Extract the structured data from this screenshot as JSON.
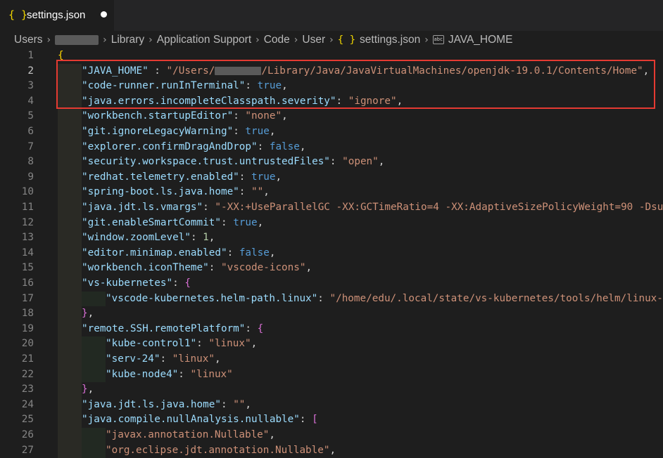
{
  "tab": {
    "icon": "json-braces-icon",
    "label": "settings.json"
  },
  "breadcrumb": {
    "items": [
      "Users",
      "Library",
      "Application Support",
      "Code",
      "User"
    ],
    "file": "settings.json",
    "symbol": "JAVA_HOME",
    "symbol_icon_text": "abc"
  },
  "lines": [
    {
      "n": "1",
      "parts": [
        [
          "br1",
          "{"
        ]
      ]
    },
    {
      "n": "2",
      "parts": [
        [
          "k",
          "\"JAVA_HOME\""
        ],
        [
          "p",
          " : "
        ],
        [
          "s",
          "\"/Users/"
        ],
        [
          "r",
          ""
        ],
        [
          "s",
          "/Library/Java/JavaVirtualMachines/openjdk-19.0.1/Contents/Home\""
        ],
        [
          "p",
          ","
        ]
      ]
    },
    {
      "n": "3",
      "parts": [
        [
          "k",
          "\"code-runner.runInTerminal\""
        ],
        [
          "p",
          ": "
        ],
        [
          "b",
          "true"
        ],
        [
          "p",
          ","
        ]
      ]
    },
    {
      "n": "4",
      "parts": [
        [
          "k",
          "\"java.errors.incompleteClasspath.severity\""
        ],
        [
          "p",
          ": "
        ],
        [
          "s",
          "\"ignore\""
        ],
        [
          "p",
          ","
        ]
      ]
    },
    {
      "n": "5",
      "parts": [
        [
          "k",
          "\"workbench.startupEditor\""
        ],
        [
          "p",
          ": "
        ],
        [
          "s",
          "\"none\""
        ],
        [
          "p",
          ","
        ]
      ]
    },
    {
      "n": "6",
      "parts": [
        [
          "k",
          "\"git.ignoreLegacyWarning\""
        ],
        [
          "p",
          ": "
        ],
        [
          "b",
          "true"
        ],
        [
          "p",
          ","
        ]
      ]
    },
    {
      "n": "7",
      "parts": [
        [
          "k",
          "\"explorer.confirmDragAndDrop\""
        ],
        [
          "p",
          ": "
        ],
        [
          "b",
          "false"
        ],
        [
          "p",
          ","
        ]
      ]
    },
    {
      "n": "8",
      "parts": [
        [
          "k",
          "\"security.workspace.trust.untrustedFiles\""
        ],
        [
          "p",
          ": "
        ],
        [
          "s",
          "\"open\""
        ],
        [
          "p",
          ","
        ]
      ]
    },
    {
      "n": "9",
      "parts": [
        [
          "k",
          "\"redhat.telemetry.enabled\""
        ],
        [
          "p",
          ": "
        ],
        [
          "b",
          "true"
        ],
        [
          "p",
          ","
        ]
      ]
    },
    {
      "n": "10",
      "parts": [
        [
          "k",
          "\"spring-boot.ls.java.home\""
        ],
        [
          "p",
          ": "
        ],
        [
          "s",
          "\"\""
        ],
        [
          "p",
          ","
        ]
      ]
    },
    {
      "n": "11",
      "parts": [
        [
          "k",
          "\"java.jdt.ls.vmargs\""
        ],
        [
          "p",
          ": "
        ],
        [
          "s",
          "\"-XX:+UseParallelGC -XX:GCTimeRatio=4 -XX:AdaptiveSizePolicyWeight=90 -Dsu"
        ]
      ]
    },
    {
      "n": "12",
      "parts": [
        [
          "k",
          "\"git.enableSmartCommit\""
        ],
        [
          "p",
          ": "
        ],
        [
          "b",
          "true"
        ],
        [
          "p",
          ","
        ]
      ]
    },
    {
      "n": "13",
      "parts": [
        [
          "k",
          "\"window.zoomLevel\""
        ],
        [
          "p",
          ": "
        ],
        [
          "n",
          "1"
        ],
        [
          "p",
          ","
        ]
      ]
    },
    {
      "n": "14",
      "parts": [
        [
          "k",
          "\"editor.minimap.enabled\""
        ],
        [
          "p",
          ": "
        ],
        [
          "b",
          "false"
        ],
        [
          "p",
          ","
        ]
      ]
    },
    {
      "n": "15",
      "parts": [
        [
          "k",
          "\"workbench.iconTheme\""
        ],
        [
          "p",
          ": "
        ],
        [
          "s",
          "\"vscode-icons\""
        ],
        [
          "p",
          ","
        ]
      ]
    },
    {
      "n": "16",
      "parts": [
        [
          "k",
          "\"vs-kubernetes\""
        ],
        [
          "p",
          ": "
        ],
        [
          "br2",
          "{"
        ]
      ]
    },
    {
      "n": "17",
      "parts": [
        [
          "k",
          "\"vscode-kubernetes.helm-path.linux\""
        ],
        [
          "p",
          ": "
        ],
        [
          "s",
          "\"/home/edu/.local/state/vs-kubernetes/tools/helm/linux-"
        ]
      ]
    },
    {
      "n": "18",
      "parts": [
        [
          "br2",
          "}"
        ],
        [
          "p",
          ","
        ]
      ]
    },
    {
      "n": "19",
      "parts": [
        [
          "k",
          "\"remote.SSH.remotePlatform\""
        ],
        [
          "p",
          ": "
        ],
        [
          "br2",
          "{"
        ]
      ]
    },
    {
      "n": "20",
      "parts": [
        [
          "k",
          "\"kube-control1\""
        ],
        [
          "p",
          ": "
        ],
        [
          "s",
          "\"linux\""
        ],
        [
          "p",
          ","
        ]
      ]
    },
    {
      "n": "21",
      "parts": [
        [
          "k",
          "\"serv-24\""
        ],
        [
          "p",
          ": "
        ],
        [
          "s",
          "\"linux\""
        ],
        [
          "p",
          ","
        ]
      ]
    },
    {
      "n": "22",
      "parts": [
        [
          "k",
          "\"kube-node4\""
        ],
        [
          "p",
          ": "
        ],
        [
          "s",
          "\"linux\""
        ]
      ]
    },
    {
      "n": "23",
      "parts": [
        [
          "br2",
          "}"
        ],
        [
          "p",
          ","
        ]
      ]
    },
    {
      "n": "24",
      "parts": [
        [
          "k",
          "\"java.jdt.ls.java.home\""
        ],
        [
          "p",
          ": "
        ],
        [
          "s",
          "\"\""
        ],
        [
          "p",
          ","
        ]
      ]
    },
    {
      "n": "25",
      "parts": [
        [
          "k",
          "\"java.compile.nullAnalysis.nullable\""
        ],
        [
          "p",
          ": "
        ],
        [
          "br2",
          "["
        ]
      ]
    },
    {
      "n": "26",
      "parts": [
        [
          "s",
          "\"javax.annotation.Nullable\""
        ],
        [
          "p",
          ","
        ]
      ]
    },
    {
      "n": "27",
      "parts": [
        [
          "s",
          "\"org.eclipse.jdt.annotation.Nullable\""
        ],
        [
          "p",
          ","
        ]
      ]
    }
  ],
  "indent_levels": [
    0,
    1,
    1,
    1,
    1,
    1,
    1,
    1,
    1,
    1,
    1,
    1,
    1,
    1,
    1,
    1,
    2,
    1,
    1,
    2,
    2,
    2,
    1,
    1,
    1,
    2,
    2
  ],
  "active_line": "2",
  "colors": {
    "background": "#1e1e1e",
    "key": "#9cdcfe",
    "string": "#ce9178",
    "boolean": "#569cd6",
    "number": "#b5cea8",
    "highlight_border": "#e53a32"
  }
}
